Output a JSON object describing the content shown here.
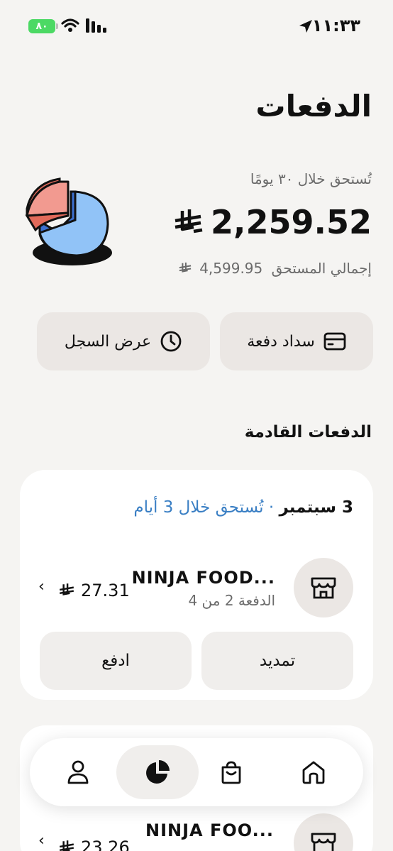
{
  "status_bar": {
    "battery": "٨٠",
    "time": "١١:٣٣"
  },
  "page": {
    "title": "الدفعات"
  },
  "summary": {
    "due_label": "تُستحق خلال ٣٠ يومًا",
    "due_amount": "2,259.52",
    "total_label": "إجمالي المستحق",
    "total_amount": "4,599.95"
  },
  "actions": {
    "pay_label": "سداد دفعة",
    "history_label": "عرض السجل"
  },
  "upcoming": {
    "title": "الدفعات القادمة",
    "cards": [
      {
        "date": "3 سبتمبر",
        "separator": " · ",
        "due_in": "تُستحق خلال 3 أيام",
        "merchant": "NINJA FOOD...",
        "installment": "الدفعة 2 من 4",
        "amount": "27.31",
        "extend_label": "تمديد",
        "pay_label": "ادفع"
      },
      {
        "merchant": "NINJA FOO...",
        "amount": "23.26"
      }
    ]
  },
  "colors": {
    "accent_blue": "#3a7fc4",
    "battery_green": "#4cd964",
    "background": "#f5f4f2",
    "button_bg": "#ebe7e4"
  },
  "icons": {
    "currency": "riyal-icon",
    "pay": "credit-card-icon",
    "history": "clock-icon",
    "store": "store-icon",
    "nav": [
      "home-icon",
      "shopping-bag-icon",
      "pie-chart-icon",
      "user-icon"
    ]
  }
}
